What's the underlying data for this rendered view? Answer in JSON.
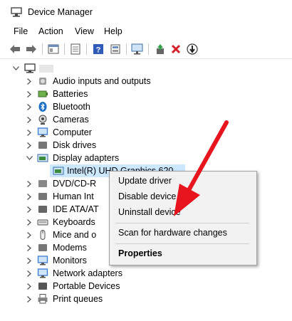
{
  "window": {
    "title": "Device Manager"
  },
  "menu": {
    "items": [
      "File",
      "Action",
      "View",
      "Help"
    ]
  },
  "toolbar": {
    "buttons": [
      "back-icon",
      "forward-icon",
      "properties-icon",
      "show-hide-icon",
      "help-icon",
      "scan-icon",
      "update-driver-icon",
      "uninstall-icon",
      "disable-icon"
    ]
  },
  "tree": {
    "root_label": "",
    "items": [
      {
        "label": "Audio inputs and outputs",
        "icon": "speaker-icon"
      },
      {
        "label": "Batteries",
        "icon": "battery-icon"
      },
      {
        "label": "Bluetooth",
        "icon": "bluetooth-icon"
      },
      {
        "label": "Cameras",
        "icon": "camera-icon"
      },
      {
        "label": "Computer",
        "icon": "computer-icon"
      },
      {
        "label": "Disk drives",
        "icon": "disk-icon"
      },
      {
        "label": "Display adapters",
        "icon": "display-adapter-icon"
      },
      {
        "label": "Intel(R) UHD Graphics 620",
        "icon": "graphics-icon"
      },
      {
        "label": "DVD/CD-R",
        "icon": "dvd-icon"
      },
      {
        "label": "Human Int",
        "icon": "hid-icon"
      },
      {
        "label": "IDE ATA/AT",
        "icon": "ide-icon"
      },
      {
        "label": "Keyboards",
        "icon": "keyboard-icon"
      },
      {
        "label": "Mice and o",
        "icon": "mouse-icon"
      },
      {
        "label": "Modems",
        "icon": "modem-icon"
      },
      {
        "label": "Monitors",
        "icon": "monitor-icon"
      },
      {
        "label": "Network adapters",
        "icon": "network-icon"
      },
      {
        "label": "Portable Devices",
        "icon": "portable-icon"
      },
      {
        "label": "Print queues",
        "icon": "printer-icon"
      }
    ]
  },
  "context_menu": {
    "update_driver": "Update driver",
    "disable_device": "Disable device",
    "uninstall_device": "Uninstall device",
    "scan": "Scan for hardware changes",
    "properties": "Properties"
  },
  "colors": {
    "selection": "#cce8ff",
    "arrow": "#e8141e",
    "accent": "#1a6fc4"
  }
}
